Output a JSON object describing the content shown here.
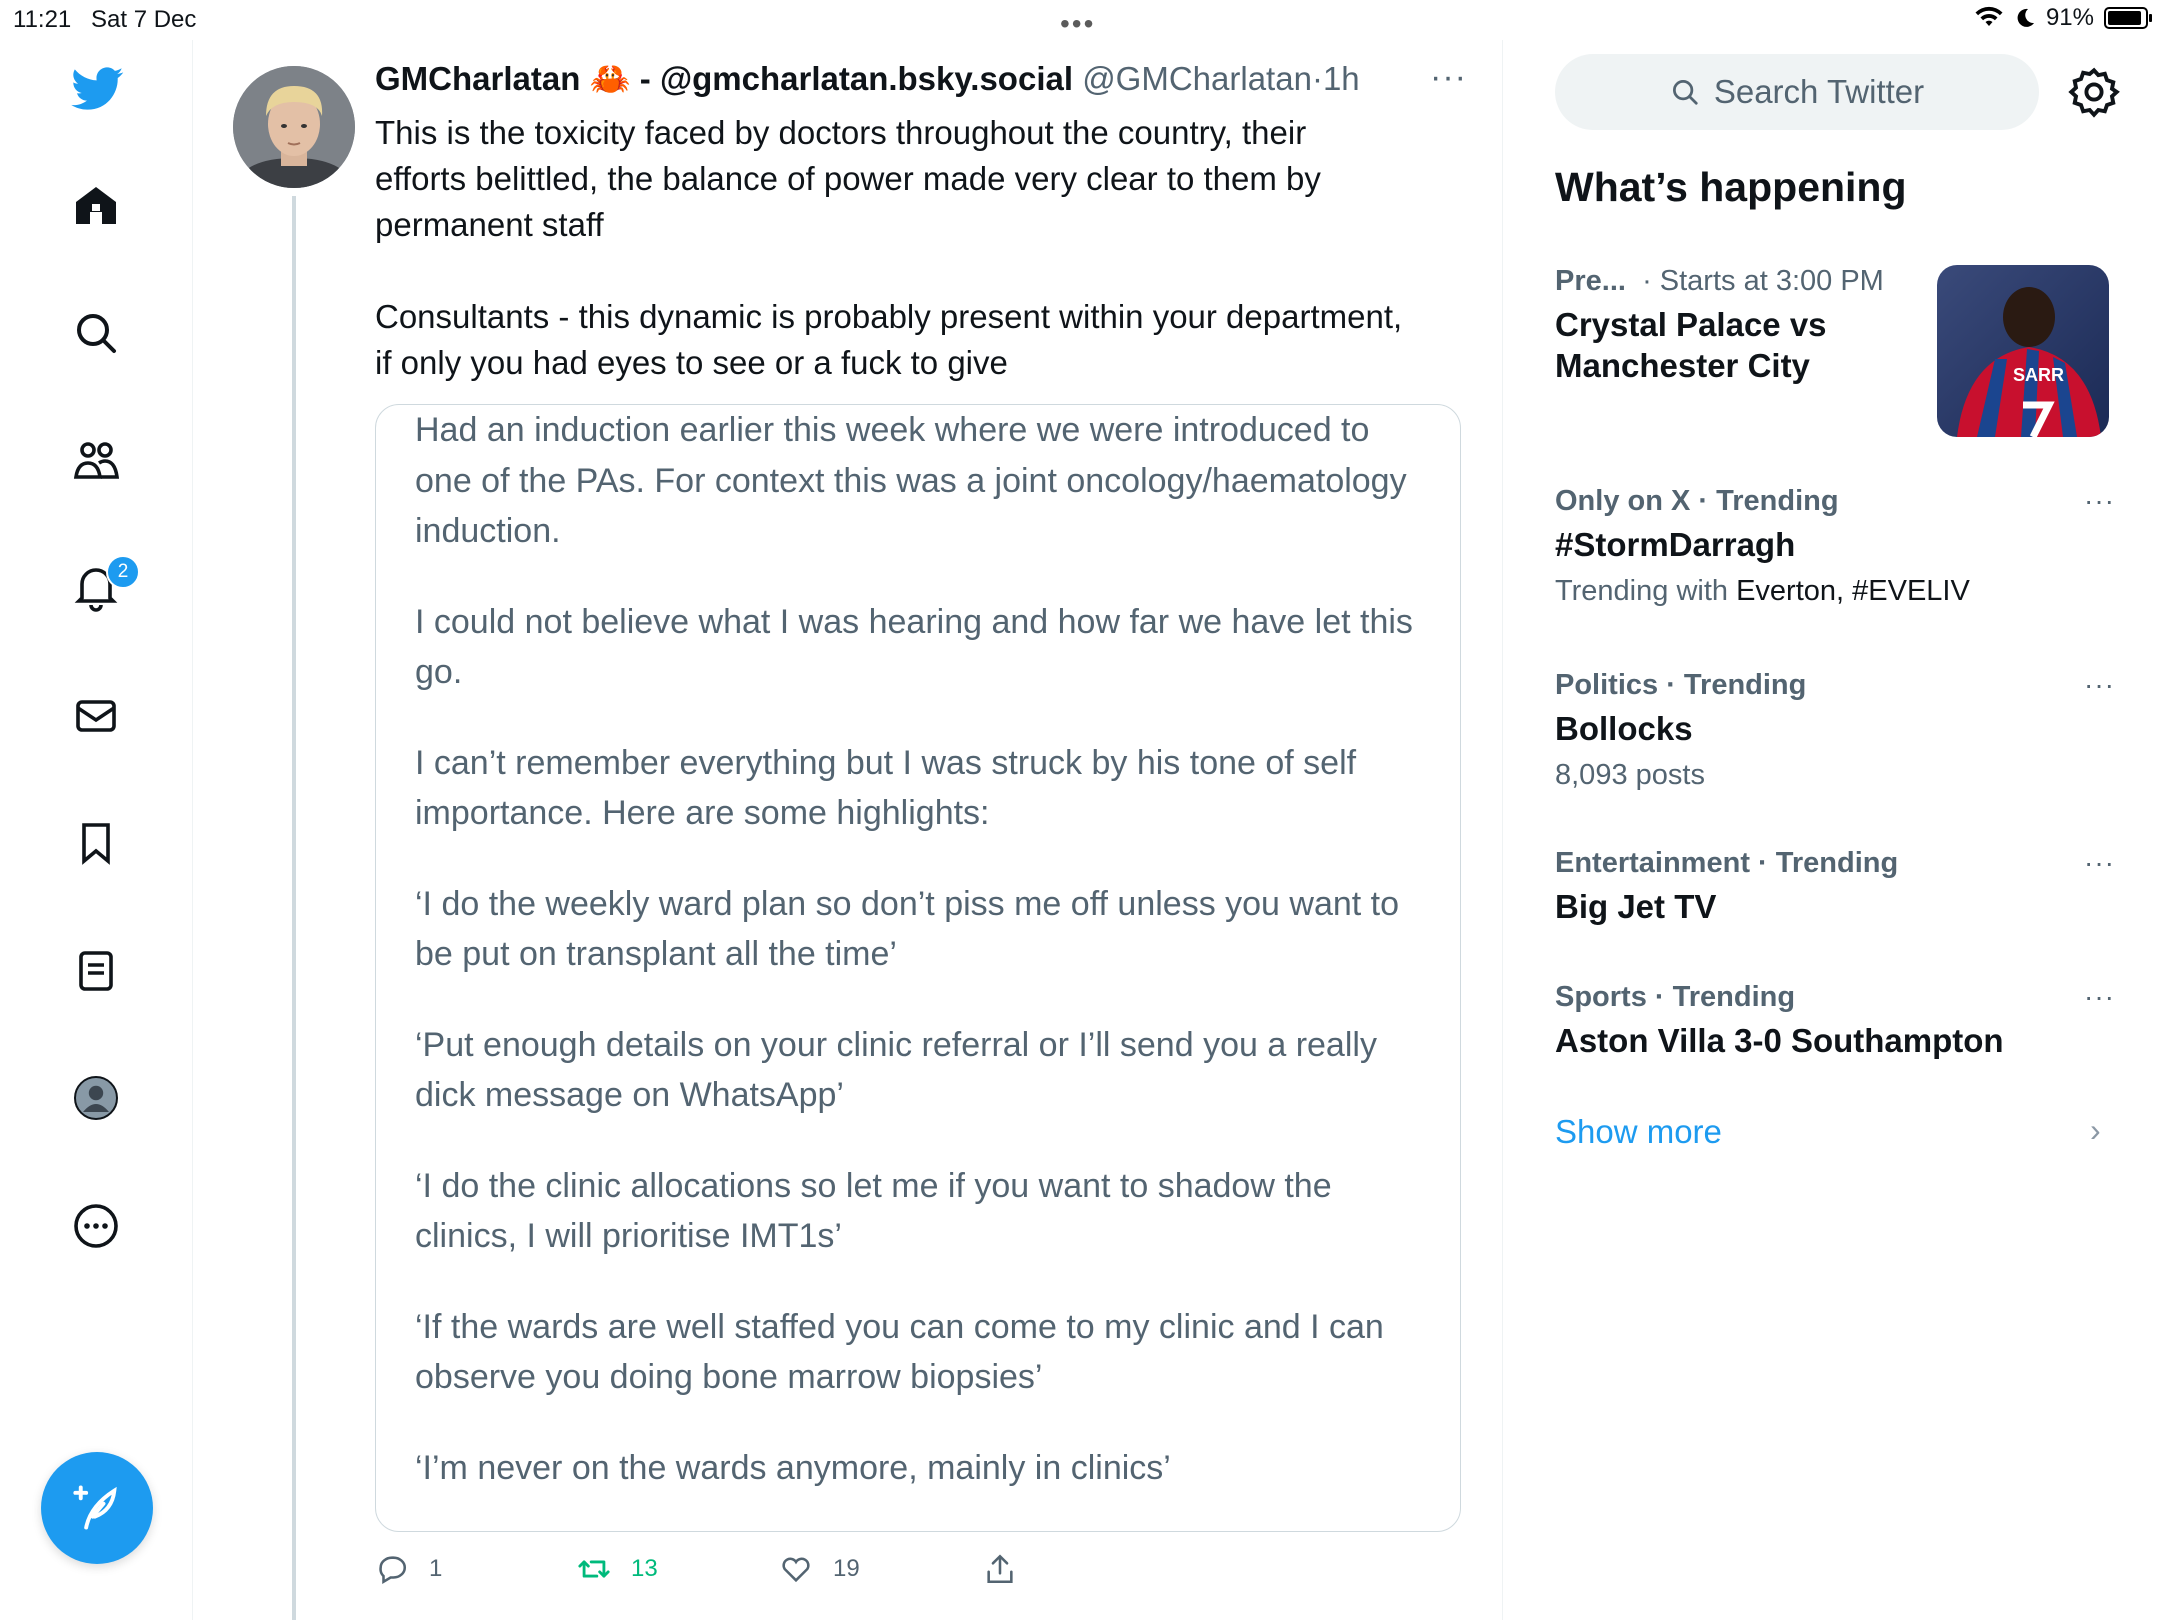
{
  "status_bar": {
    "time": "11:21",
    "date": "Sat 7 Dec",
    "battery": "91%",
    "battery_level": 0.91,
    "center_dots": "•••"
  },
  "nav": {
    "items": [
      "home-icon",
      "explore-icon",
      "communities-icon",
      "notifications-icon",
      "messages-icon",
      "bookmarks-icon",
      "lists-icon",
      "profile-icon",
      "more-icon"
    ],
    "notifications_badge": "2",
    "accent": "#1d9bf0"
  },
  "tweet": {
    "display_name": "GMCharlatan 🦀 - @gmcharlatan.bsky.social",
    "handle": "@GMCharlatan",
    "separator": "·",
    "time": "1h",
    "more": "···",
    "text": "This is the toxicity faced by doctors throughout the country, their\nefforts belittled, the balance of power made very clear to them by\npermanent staff\n\nConsultants - this dynamic is probably present within your department,\nif only you had eyes to see or a fuck to give",
    "quote_paragraphs": [
      "Had an induction earlier this week where we were introduced to one of the PAs. For context this was a joint oncology/haematology induction.",
      "I could not believe what I was hearing and how far we have let this go.",
      "I can’t remember everything but I was struck by his tone of self importance. Here are some highlights:",
      "‘I do the weekly ward plan so don’t piss me off unless you want to be put on transplant all the time’",
      "‘Put enough details on your clinic referral or I’ll send you a really dick message on WhatsApp’",
      "‘I do the clinic allocations so let me if you want to shadow the clinics, I will prioritise IMT1s’",
      "‘If the wards are well staffed you can come to my clinic and I can observe you doing bone marrow biopsies’",
      "‘I’m never on the wards anymore, mainly in clinics’"
    ],
    "actions": {
      "replies": "1",
      "retweets": "13",
      "likes": "19"
    }
  },
  "sidebar": {
    "search_placeholder": "Search Twitter",
    "title": "What’s happening",
    "featured": {
      "category": "Pre...",
      "meta": "· Starts at 3:00 PM",
      "title": "Crystal Palace vs Manchester City",
      "image_text": "SARR"
    },
    "trends": [
      {
        "category": "Only on X · Trending",
        "title": "#StormDarragh",
        "sub_prefix": "Trending with ",
        "sub_value": "Everton, #EVELIV"
      },
      {
        "category": "Politics · Trending",
        "title": "Bollocks",
        "sub": "8,093 posts"
      },
      {
        "category": "Entertainment · Trending",
        "title": "Big Jet TV"
      },
      {
        "category": "Sports · Trending",
        "title": "Aston Villa 3-0 Southampton"
      }
    ],
    "trend_more": "···",
    "show_more": "Show more",
    "chevron": "›"
  }
}
